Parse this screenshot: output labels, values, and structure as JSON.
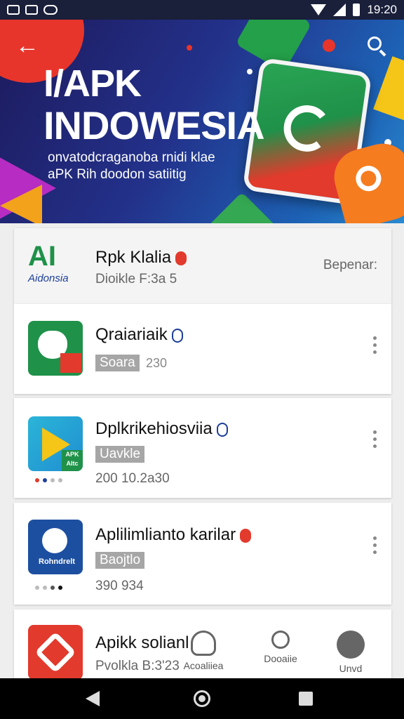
{
  "status_bar": {
    "time": "19:20"
  },
  "hero": {
    "title_line1": "I/APK",
    "title_line2": "INDOWESIA",
    "subtitle_line1": "onvatodcraganoba rnidi klae",
    "subtitle_line2": "aPK Rih doodon satiitig"
  },
  "featured": {
    "logo_text": "AI",
    "logo_caption": "Aidonsia",
    "name": "Rpk Klalia",
    "sub": "Dioikle F:3a 5",
    "action": "Bepenar:"
  },
  "apps": [
    {
      "name": "Qraiariaik",
      "pill": "Soara",
      "meta": "230"
    },
    {
      "name": "Dplkrikehiosviia",
      "pill": "Uavkle",
      "meta": "200 10.2a30"
    },
    {
      "name": "Aplilimlianto karilar",
      "pill": "Baojtlo",
      "meta": "390 934"
    },
    {
      "name": "Apikk solianl",
      "sub": "Pvolkla B:3'23"
    }
  ],
  "app_icon_labels": {
    "row3": "Rohndrelt",
    "row2_badge": "APK AItc"
  },
  "bottom_tabs": [
    {
      "label": "Acoaliiea"
    },
    {
      "label": "Dooaiie"
    },
    {
      "label": "Unvd"
    }
  ],
  "colors": {
    "status_bar": "#1a1f3a",
    "hero_start": "#1d1a5c",
    "hero_end": "#2a8ad0",
    "accent_red": "#e8352b",
    "accent_green": "#1f9149",
    "pill_gray": "#a6a6a6"
  }
}
